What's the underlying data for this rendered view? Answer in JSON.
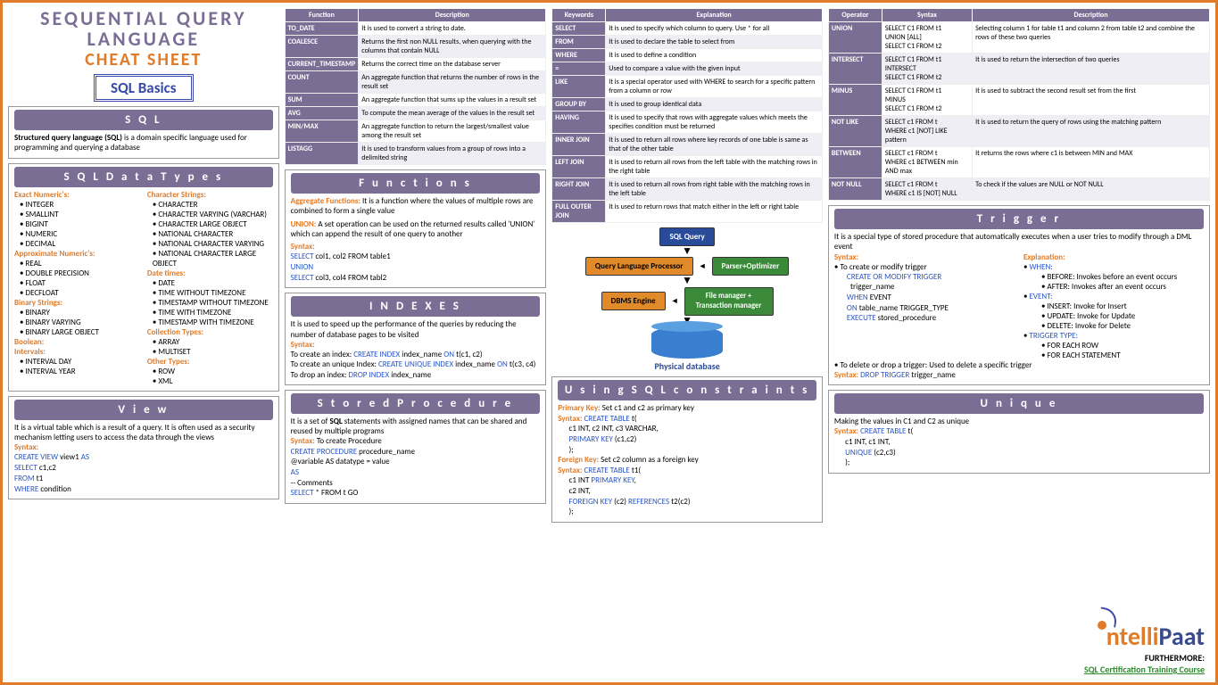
{
  "title": {
    "l1": "SEQUENTIAL QUERY",
    "l2": "LANGUAGE",
    "l3": "CHEAT SHEET",
    "badge": "SQL Basics"
  },
  "sql": {
    "header": "S Q L",
    "body": "Structured query language (SQL) is a domain specific language used for programming and querying a database"
  },
  "datatypes": {
    "header": "S Q L   D a t a   T y p e s",
    "exact_h": "Exact Numeric's:",
    "exact": [
      "INTEGER",
      "SMALLINT",
      "BIGINT",
      "NUMERIC",
      "DECIMAL"
    ],
    "approx_h": "Approximate Numeric's:",
    "approx": [
      "REAL",
      "DOUBLE PRECISION",
      "FLOAT",
      "DECFLOAT"
    ],
    "binary_h": "Binary Strings:",
    "binary": [
      "BINARY",
      "BINARY VARYING",
      "BINARY LARGE OBJECT"
    ],
    "bool_h": "Boolean:",
    "interval_h": "Intervals:",
    "interval": [
      "INTERVAL DAY",
      "INTERVAL YEAR"
    ],
    "char_h": "Character Strings:",
    "char": [
      "CHARACTER",
      "CHARACTER VARYING (VARCHAR)",
      "CHARACTER LARGE OBJECT",
      "NATIONAL CHARACTER",
      "NATIONAL CHARACTER VARYING",
      "NATIONAL CHARACTER LARGE OBJECT"
    ],
    "date_h": "Date times:",
    "date": [
      "DATE",
      "TIME WITHOUT TIMEZONE",
      "TIMESTAMP WITHOUT TIMEZONE",
      "TIME WITH TIMEZONE",
      "TIMESTAMP WITH TIMEZONE"
    ],
    "coll_h": "Collection Types:",
    "coll": [
      "ARRAY",
      "MULTISET"
    ],
    "other_h": "Other Types:",
    "other": [
      "ROW",
      "XML"
    ]
  },
  "view": {
    "header": "V i e w",
    "body": "It is a virtual table which is a result of a query. It is often used as a security mechanism letting users to access the data through the views",
    "syntax_h": "Syntax:",
    "code": [
      [
        "CREATE VIEW",
        " view1 ",
        "AS",
        ""
      ],
      [
        "SELECT",
        " c1,c2",
        "",
        ""
      ],
      [
        "FROM",
        " t1",
        "",
        ""
      ],
      [
        "WHERE",
        " condition",
        "",
        ""
      ]
    ]
  },
  "func_table": {
    "h1": "Function",
    "h2": "Description",
    "rows": [
      [
        "TO_DATE",
        "It is used to convert a string to date."
      ],
      [
        "COALESCE",
        "Returns the first non NULL results, when querying with the columns that contain NULL"
      ],
      [
        "CURRENT_TIMESTAMP",
        "Returns the correct time on the database server"
      ],
      [
        "COUNT",
        "An aggregate function that returns the number of rows in the result set"
      ],
      [
        "SUM",
        "An aggregate function that sums up the values in a result set"
      ],
      [
        "AVG",
        "To compute the mean average of the values in the result set"
      ],
      [
        "MIN/MAX",
        "An aggregate function to return the largest/smallest value among the result set"
      ],
      [
        "LISTAGG",
        "It is used to transform values from a group of rows into a delimited string"
      ]
    ]
  },
  "functions": {
    "header": "F u n c t i o n s",
    "agg_h": "Aggregate Functions:",
    "agg": " It is a function where the values of multiple rows are combined to form a single value",
    "union_h": "UNION:",
    "union": " A set operation can be used on the returned results called 'UNION' which can append the result of one query to another",
    "syntax_h": "Syntax:",
    "code": [
      "SELECT col1, col2 FROM table1",
      "UNION",
      "SELECT col3, col4 FROM tabl2"
    ],
    "code_kw": [
      "SELECT",
      "UNION",
      "SELECT"
    ]
  },
  "indexes": {
    "header": "I N D E X E S",
    "body": "It is used to speed up the performance of the queries by reducing the number of database pages to be visited",
    "syntax_h": "Syntax:",
    "l1_pre": "To create an index: ",
    "l1_kw": "CREATE INDEX",
    "l1_post": " index_name ON t(c1, c2)",
    "l2_pre": "To create an unique Index: ",
    "l2_kw": "CREATE UNIQUE INDEX",
    "l2_post": " index_name ON t(c3, c4)",
    "l3_pre": "To drop an index: ",
    "l3_kw": "DROP INDEX",
    "l3_post": " index_name"
  },
  "sproc": {
    "header": "S t o r e d   P r o c e d u r e",
    "body": "It is a set of SQL statements with assigned names that can be shared and reused by multiple programs",
    "syntax_h": "Syntax:",
    "syntax_t": " To create Procedure",
    "code": [
      "CREATE PROCEDURE procedure_name",
      "@variable AS datatype = value",
      "AS",
      "-- Comments",
      "SELECT * FROM t GO"
    ]
  },
  "kw_table": {
    "h1": "Keywords",
    "h2": "Explanation",
    "rows": [
      [
        "SELECT",
        "It is used to specify which column to query. Use * for all"
      ],
      [
        "FROM",
        "It is used to declare the table to select from"
      ],
      [
        "WHERE",
        "It is used to define a condition"
      ],
      [
        "=",
        "Used to compare a value with the given input"
      ],
      [
        "LIKE",
        "It is a special operator used with WHERE to search for a specific pattern from a column or row"
      ],
      [
        "GROUP BY",
        "It is used to group identical data"
      ],
      [
        "HAVING",
        "It is used to specify that rows with aggregate values which meets the specifies condition must be returned"
      ],
      [
        "INNER JOIN",
        "It is used to return all rows where key records of one table is same as that of the other table"
      ],
      [
        "LEFT JOIN",
        "It is used to return all rows from the left table with the matching rows in the right table"
      ],
      [
        "RIGHT JOIN",
        "It is used to return all rows from right table with the matching rows in the left table"
      ],
      [
        "FULL OUTER JOIN",
        "It is used to return rows that match either in the left or right table"
      ]
    ]
  },
  "flow": {
    "b1": "SQL Query",
    "b2": "Query Language Processor",
    "s2": "Parser+Optimizer",
    "b3": "DBMS Engine",
    "s3": "File manager + Transaction manager",
    "pd": "Physical database"
  },
  "constraints": {
    "header": "U s i n g   S Q L   c o n s t r a i n t s",
    "pk_h": "Primary Key:",
    "pk_t": " Set c1 and c2 as primary key",
    "fk_h": "Foreign Key:",
    "fk_t": " Set c2 column as a foreign key"
  },
  "op_table": {
    "h1": "Operator",
    "h2": "Syntax",
    "h3": "Description",
    "rows": [
      [
        "UNION",
        "SELECT C1 FROM t1\nUNION [ALL]\nSELECT C1 FROM t2",
        "Selecting column 1 for table t1 and column 2 from table t2 and combine the rows of these two queries"
      ],
      [
        "INTERSECT",
        "SELECT C1 FROM t1\nINTERSECT\nSELECT C1 FROM t2",
        "It is used to return the intersection of two queries"
      ],
      [
        "MINUS",
        "SELECT C1 FROM t1\nMINUS\nSELECT C1 FROM t2",
        "It is used to subtract the second result set from the first"
      ],
      [
        "NOT LIKE",
        "SELECT c1 FROM t\nWHERE c1 [NOT] LIKE pattern",
        "It is used to return the query of rows using the matching pattern"
      ],
      [
        "BETWEEN",
        "SELECT c1 FROM t\nWHERE c1 BETWEEN min AND max",
        "It returns the rows where c1 is between MIN and MAX"
      ],
      [
        "NOT NULL",
        "SELECT c1 FROM t\nWHERE c1 IS [NOT] NULL",
        "To check if the values are NULL or NOT NULL"
      ]
    ]
  },
  "trigger": {
    "header": "T r i g g e r",
    "body": "It is a special type of stored procedure that automatically executes when a user tries to modify through a DML event",
    "syntax_h": "Syntax:",
    "exp_h": "Explanation:",
    "s1": "To create or modify trigger",
    "when_h": "WHEN:",
    "when": [
      "BEFORE: Invokes before an event occurs",
      "AFTER: Invokes after an event occurs"
    ],
    "event_h": "EVENT:",
    "event": [
      "INSERT: Invoke for Insert",
      "UPDATE: Invoke for Update",
      "DELETE: Invoke for Delete"
    ],
    "tt_h": "TRIGGER TYPE:",
    "tt": [
      "FOR EACH ROW",
      "FOR EACH STATEMENT"
    ],
    "del": "To delete or drop a trigger: Used to delete a specific trigger",
    "del_syn_h": "Syntax:",
    "del_syn": " DROP TRIGGER trigger_name"
  },
  "unique": {
    "header": "U n i q u e",
    "body": "Making the values in C1 and C2 as unique"
  },
  "footer": {
    "brand1": "ntelli",
    "brand2": "Paat",
    "more": "FURTHERMORE:",
    "link": "SQL Certification Training Course"
  }
}
